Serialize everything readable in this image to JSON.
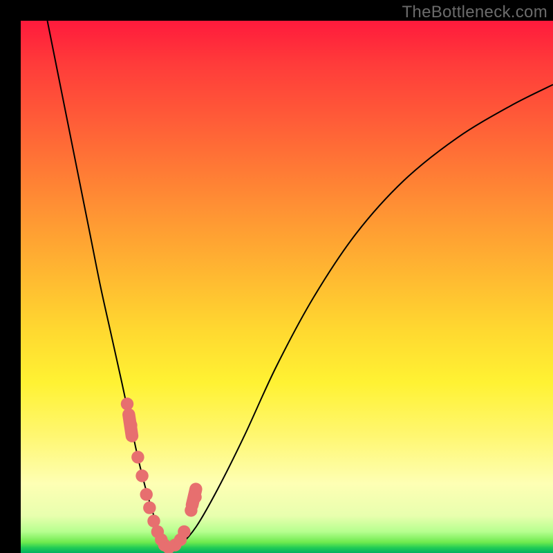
{
  "watermark": "TheBottleneck.com",
  "chart_data": {
    "type": "line",
    "title": "",
    "xlabel": "",
    "ylabel": "",
    "xlim": [
      0,
      100
    ],
    "ylim": [
      0,
      100
    ],
    "grid": false,
    "legend": false,
    "series": [
      {
        "name": "bottleneck-curve",
        "x": [
          5,
          7,
          9,
          11,
          13,
          15,
          17,
          19,
          20.5,
          22,
          23.5,
          25,
          26,
          27,
          28,
          30,
          33,
          37,
          42,
          48,
          55,
          63,
          72,
          82,
          92,
          100
        ],
        "y": [
          100,
          90,
          80,
          70,
          60,
          50,
          41,
          32,
          25,
          18,
          12,
          7,
          3.5,
          1.5,
          0.5,
          1.5,
          5,
          12,
          22,
          35,
          48,
          60,
          70,
          78,
          84,
          88
        ]
      },
      {
        "name": "highlighted-points",
        "type": "scatter",
        "x": [
          20.0,
          20.7,
          22.0,
          22.8,
          23.6,
          24.2,
          25.0,
          25.7,
          26.4,
          27.0,
          27.8,
          29.0,
          30.0,
          30.7,
          32.0,
          32.8
        ],
        "y": [
          28.0,
          24.0,
          18.0,
          14.5,
          11.0,
          8.5,
          6.0,
          4.0,
          2.5,
          1.5,
          1.0,
          1.5,
          2.5,
          4.0,
          8.0,
          10.5
        ]
      }
    ],
    "colors": {
      "curve": "#000000",
      "points": "#e76f6f",
      "gradient_top": "#ff1a3c",
      "gradient_mid": "#ffd830",
      "gradient_bottom": "#00b060"
    }
  }
}
